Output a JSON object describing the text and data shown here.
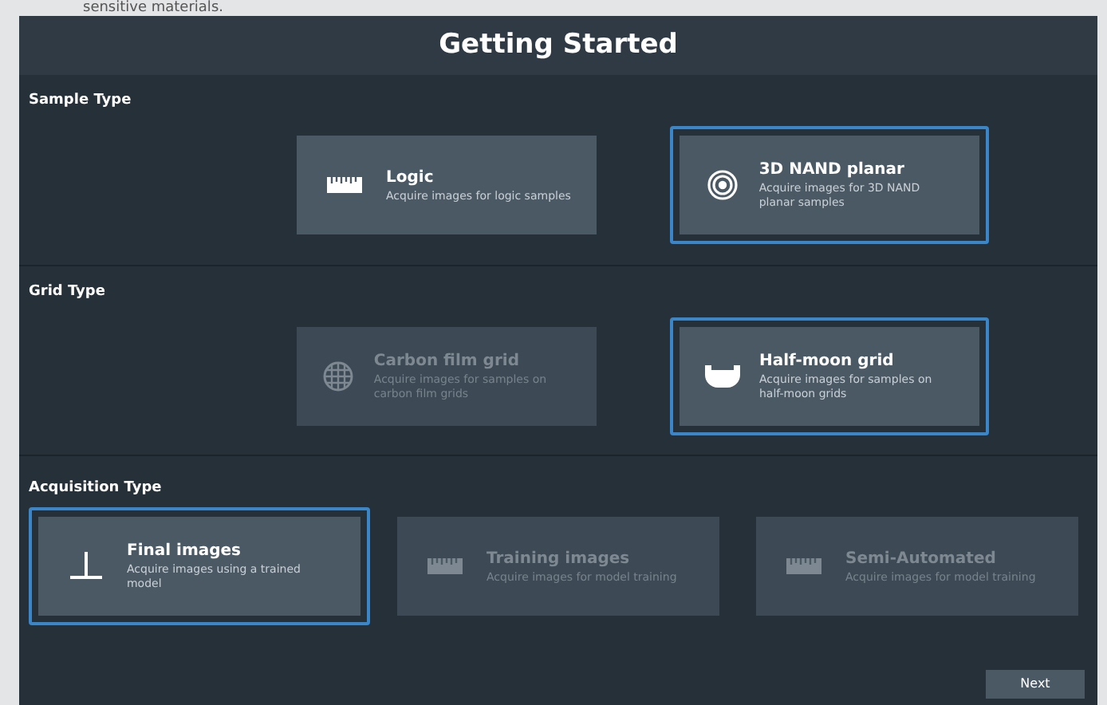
{
  "caption": "sensitive materials.",
  "title": "Getting Started",
  "sections": [
    {
      "label": "Sample Type",
      "options": [
        {
          "kind": "ruler",
          "title": "Logic",
          "description": "Acquire images for logic samples",
          "selected": false,
          "disabled": false
        },
        {
          "kind": "target",
          "title": "3D NAND planar",
          "description": "Acquire images for 3D NAND planar samples",
          "selected": true,
          "disabled": false
        }
      ]
    },
    {
      "label": "Grid Type",
      "options": [
        {
          "kind": "globe",
          "title": "Carbon film grid",
          "description": "Acquire images for samples on carbon film grids",
          "selected": false,
          "disabled": true
        },
        {
          "kind": "halfmoon",
          "title": "Half-moon grid",
          "description": "Acquire images for samples on half-moon grids",
          "selected": true,
          "disabled": false
        }
      ]
    },
    {
      "label": "Acquisition Type",
      "options": [
        {
          "kind": "tee",
          "title": "Final images",
          "description": "Acquire images using a trained model",
          "selected": true,
          "disabled": false
        },
        {
          "kind": "ruler",
          "title": "Training images",
          "description": "Acquire images for model training",
          "selected": false,
          "disabled": true
        },
        {
          "kind": "ruler",
          "title": "Semi-Automated",
          "description": "Acquire images for model training",
          "selected": false,
          "disabled": true
        }
      ]
    }
  ],
  "next_button": "Next"
}
